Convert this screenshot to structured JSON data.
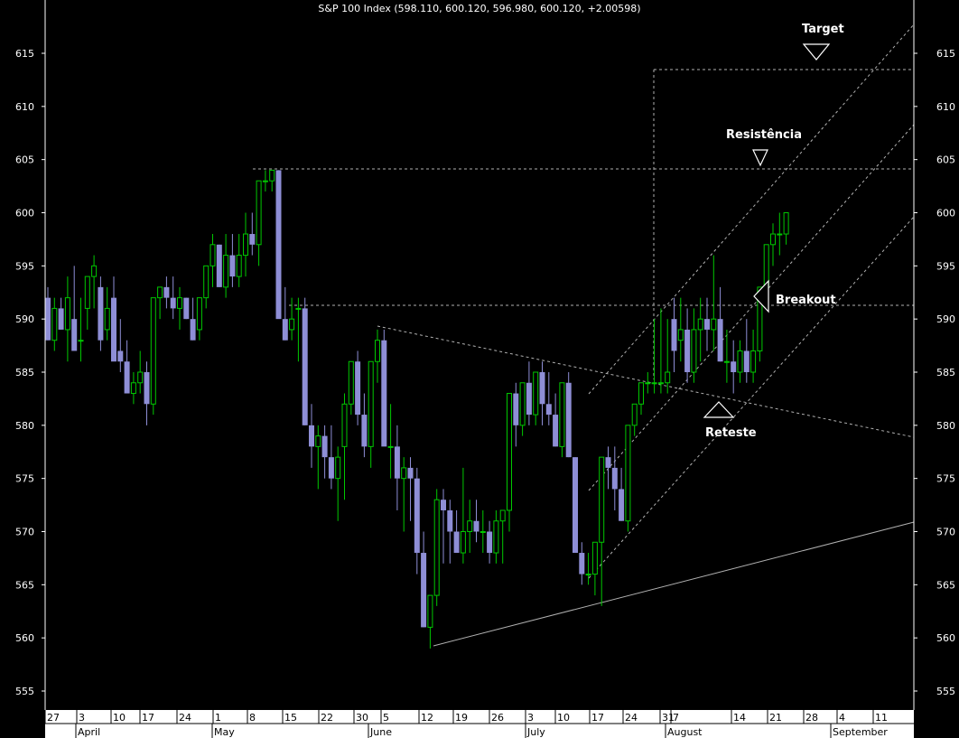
{
  "chart_data": {
    "type": "candlestick",
    "title": "S&P 100 Index (598.110, 600.120, 596.980, 600.120, +2.00598)",
    "ylim": [
      553,
      618
    ],
    "y_ticks": [
      555,
      560,
      565,
      570,
      575,
      580,
      585,
      590,
      595,
      600,
      605,
      610,
      615
    ],
    "grid": false,
    "x_date_labels": [
      "27",
      "3",
      "10",
      "17",
      "24",
      "1",
      "8",
      "15",
      "22",
      "30",
      "5",
      "12",
      "19",
      "26",
      "3",
      "10",
      "17",
      "24",
      "31",
      "7",
      "14",
      "21",
      "28",
      "4",
      "11"
    ],
    "x_month_labels": [
      "April",
      "May",
      "June",
      "July",
      "August",
      "September"
    ],
    "colors": {
      "background": "#000000",
      "up": "#00c800",
      "down": "#8e8ed6",
      "guide": "#b0b0b0",
      "axis_bar": "#ffffff"
    },
    "candles": [
      [
        592,
        593,
        588,
        588
      ],
      [
        588,
        592,
        587,
        591
      ],
      [
        591,
        592,
        589,
        589
      ],
      [
        589,
        594,
        586,
        592
      ],
      [
        590,
        595,
        588,
        587
      ],
      [
        588,
        592,
        586,
        588
      ],
      [
        591,
        594,
        589,
        594
      ],
      [
        594,
        596,
        591,
        595
      ],
      [
        593,
        594,
        587,
        588
      ],
      [
        589,
        593,
        588,
        591
      ],
      [
        592,
        594,
        588,
        586
      ],
      [
        587,
        590,
        585,
        586
      ],
      [
        586,
        588,
        583,
        583
      ],
      [
        583,
        585,
        582,
        584
      ],
      [
        584,
        587,
        583,
        585
      ],
      [
        585,
        586,
        580,
        582
      ],
      [
        582,
        586,
        581,
        592
      ],
      [
        592,
        593,
        590,
        593
      ],
      [
        593,
        594,
        591,
        592
      ],
      [
        592,
        594,
        590,
        591
      ],
      [
        591,
        593,
        589,
        592
      ],
      [
        592,
        592,
        590,
        590
      ],
      [
        590,
        592,
        588,
        588
      ],
      [
        589,
        592,
        588,
        592
      ],
      [
        592,
        595,
        591,
        595
      ],
      [
        595,
        598,
        593,
        597
      ],
      [
        597,
        597,
        593,
        593
      ],
      [
        593,
        598,
        592,
        596
      ],
      [
        596,
        598,
        593,
        594
      ],
      [
        594,
        598,
        593,
        596
      ],
      [
        596,
        600,
        594,
        598
      ],
      [
        598,
        600,
        596,
        597
      ],
      [
        597,
        603,
        595,
        603
      ],
      [
        603,
        604,
        602,
        603
      ],
      [
        603,
        604,
        602,
        604
      ],
      [
        604,
        604,
        600,
        590
      ],
      [
        590,
        593,
        588,
        588
      ],
      [
        589,
        592,
        588,
        590
      ],
      [
        591,
        592,
        586,
        591
      ],
      [
        591,
        592,
        580,
        580
      ],
      [
        580,
        582,
        576,
        578
      ],
      [
        578,
        580,
        574,
        579
      ],
      [
        579,
        580,
        575,
        577
      ],
      [
        577,
        580,
        574,
        575
      ],
      [
        575,
        578,
        571,
        577
      ],
      [
        578,
        583,
        573,
        582
      ],
      [
        582,
        586,
        581,
        586
      ],
      [
        586,
        587,
        580,
        581
      ],
      [
        581,
        583,
        577,
        578
      ],
      [
        578,
        582,
        576,
        586
      ],
      [
        586,
        589,
        584,
        588
      ],
      [
        588,
        589,
        584,
        578
      ],
      [
        578,
        582,
        575,
        578
      ],
      [
        578,
        580,
        572,
        575
      ],
      [
        575,
        577,
        570,
        576
      ],
      [
        576,
        577,
        571,
        575
      ],
      [
        575,
        576,
        566,
        568
      ],
      [
        568,
        570,
        561,
        561
      ],
      [
        561,
        564,
        559,
        564
      ],
      [
        564,
        574,
        563,
        573
      ],
      [
        573,
        574,
        567,
        572
      ],
      [
        572,
        573,
        567,
        570
      ],
      [
        570,
        572,
        568,
        568
      ],
      [
        568,
        576,
        567,
        570
      ],
      [
        570,
        573,
        568,
        571
      ],
      [
        571,
        573,
        569,
        570
      ],
      [
        570,
        572,
        568,
        570
      ],
      [
        570,
        571,
        567,
        568
      ],
      [
        568,
        572,
        567,
        571
      ],
      [
        571,
        572,
        567,
        572
      ],
      [
        572,
        583,
        570,
        583
      ],
      [
        583,
        584,
        578,
        580
      ],
      [
        580,
        584,
        579,
        584
      ],
      [
        584,
        586,
        580,
        581
      ],
      [
        581,
        585,
        580,
        585
      ],
      [
        585,
        586,
        580,
        582
      ],
      [
        582,
        585,
        580,
        581
      ],
      [
        581,
        583,
        578,
        578
      ],
      [
        578,
        584,
        577,
        584
      ],
      [
        584,
        585,
        577,
        577
      ],
      [
        577,
        577,
        568,
        568
      ],
      [
        568,
        569,
        565,
        566
      ],
      [
        566,
        568,
        565,
        566
      ],
      [
        566,
        569,
        564,
        569
      ],
      [
        569,
        573,
        563,
        577
      ],
      [
        577,
        578,
        574,
        576
      ],
      [
        576,
        578,
        572,
        574
      ],
      [
        574,
        576,
        571,
        571
      ],
      [
        571,
        577,
        570,
        580
      ],
      [
        580,
        582,
        579,
        582
      ],
      [
        582,
        584,
        581,
        584
      ],
      [
        584,
        585,
        583,
        584
      ],
      [
        584,
        590,
        583,
        584
      ],
      [
        584,
        591,
        583,
        584
      ],
      [
        584,
        590,
        583,
        585
      ],
      [
        590,
        592,
        585,
        587
      ],
      [
        588,
        592,
        586,
        589
      ],
      [
        589,
        591,
        584,
        585
      ],
      [
        585,
        591,
        584,
        589
      ],
      [
        589,
        592,
        586,
        590
      ],
      [
        590,
        592,
        587,
        589
      ],
      [
        589,
        596,
        587,
        590
      ],
      [
        590,
        593,
        586,
        586
      ],
      [
        586,
        589,
        584,
        586
      ],
      [
        586,
        588,
        583,
        585
      ],
      [
        585,
        588,
        584,
        587
      ],
      [
        587,
        590,
        584,
        585
      ],
      [
        585,
        589,
        584,
        587
      ],
      [
        587,
        593,
        586,
        593
      ],
      [
        593,
        597,
        592,
        597
      ],
      [
        597,
        599,
        595,
        598
      ],
      [
        598,
        600,
        596,
        598
      ],
      [
        598,
        600,
        597,
        600
      ]
    ],
    "annotations": [
      "Target",
      "Resistência",
      "Breakout",
      "Reteste"
    ]
  }
}
